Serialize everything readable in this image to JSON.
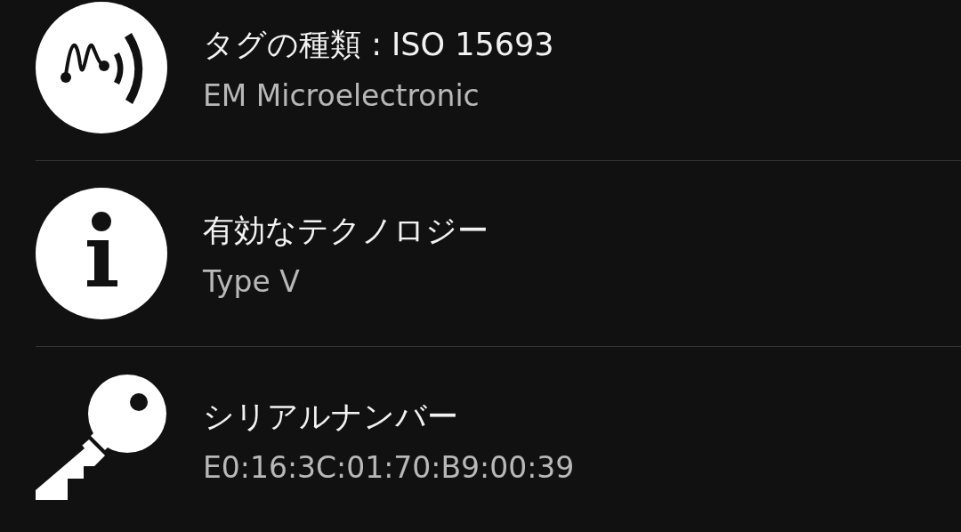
{
  "rows": [
    {
      "kind": "nfc",
      "title": "タグの種類 : ISO 15693",
      "value": "EM Microelectronic"
    },
    {
      "kind": "info",
      "title": "有効なテクノロジー",
      "value": "Type V"
    },
    {
      "kind": "key",
      "title": "シリアルナンバー",
      "value": "E0:16:3C:01:70:B9:00:39"
    }
  ]
}
